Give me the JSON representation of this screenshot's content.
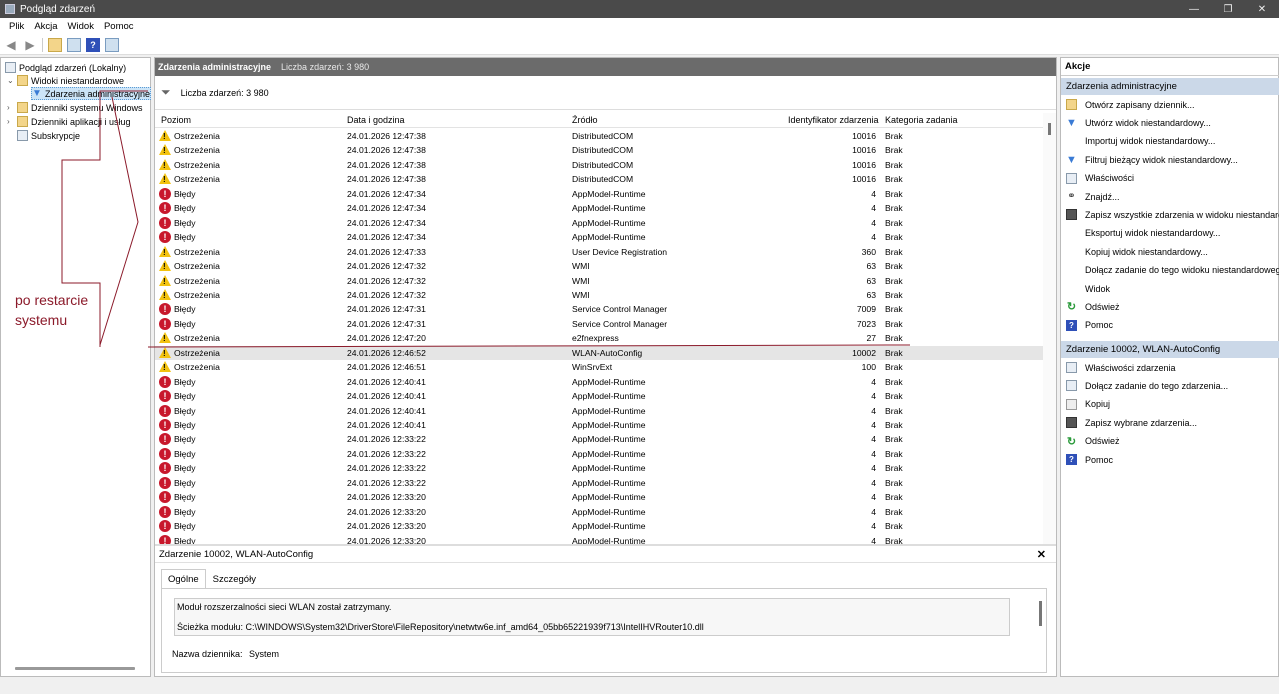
{
  "window": {
    "title": "Podgląd zdarzeń",
    "min": "—",
    "max": "❐",
    "close": "✕"
  },
  "menu": [
    "Plik",
    "Akcja",
    "Widok",
    "Pomoc"
  ],
  "tree": {
    "root": "Podgląd zdarzeń (Lokalny)",
    "custom_views": "Widoki niestandardowe",
    "admin_events": "Zdarzenia administracyjne",
    "windows_logs": "Dzienniki systemu Windows",
    "app_logs": "Dzienniki aplikacji i usług",
    "subscriptions": "Subskrypcje"
  },
  "center": {
    "header_title": "Zdarzenia administracyjne",
    "header_count": "Liczba zdarzeń: 3 980",
    "filter_text": "Liczba zdarzeń: 3 980"
  },
  "columns": [
    "Poziom",
    "Data i godzina",
    "Źródło",
    "Identyfikator zdarzenia",
    "Kategoria zadania"
  ],
  "rows": [
    {
      "level": "Ostrzeżenia",
      "type": "warn",
      "date": "24.01.2026 12:47:38",
      "source": "DistributedCOM",
      "id": "10016",
      "cat": "Brak"
    },
    {
      "level": "Ostrzeżenia",
      "type": "warn",
      "date": "24.01.2026 12:47:38",
      "source": "DistributedCOM",
      "id": "10016",
      "cat": "Brak"
    },
    {
      "level": "Ostrzeżenia",
      "type": "warn",
      "date": "24.01.2026 12:47:38",
      "source": "DistributedCOM",
      "id": "10016",
      "cat": "Brak"
    },
    {
      "level": "Ostrzeżenia",
      "type": "warn",
      "date": "24.01.2026 12:47:38",
      "source": "DistributedCOM",
      "id": "10016",
      "cat": "Brak"
    },
    {
      "level": "Błędy",
      "type": "err",
      "date": "24.01.2026 12:47:34",
      "source": "AppModel-Runtime",
      "id": "4",
      "cat": "Brak"
    },
    {
      "level": "Błędy",
      "type": "err",
      "date": "24.01.2026 12:47:34",
      "source": "AppModel-Runtime",
      "id": "4",
      "cat": "Brak"
    },
    {
      "level": "Błędy",
      "type": "err",
      "date": "24.01.2026 12:47:34",
      "source": "AppModel-Runtime",
      "id": "4",
      "cat": "Brak"
    },
    {
      "level": "Błędy",
      "type": "err",
      "date": "24.01.2026 12:47:34",
      "source": "AppModel-Runtime",
      "id": "4",
      "cat": "Brak"
    },
    {
      "level": "Ostrzeżenia",
      "type": "warn",
      "date": "24.01.2026 12:47:33",
      "source": "User Device Registration",
      "id": "360",
      "cat": "Brak"
    },
    {
      "level": "Ostrzeżenia",
      "type": "warn",
      "date": "24.01.2026 12:47:32",
      "source": "WMI",
      "id": "63",
      "cat": "Brak"
    },
    {
      "level": "Ostrzeżenia",
      "type": "warn",
      "date": "24.01.2026 12:47:32",
      "source": "WMI",
      "id": "63",
      "cat": "Brak"
    },
    {
      "level": "Ostrzeżenia",
      "type": "warn",
      "date": "24.01.2026 12:47:32",
      "source": "WMI",
      "id": "63",
      "cat": "Brak"
    },
    {
      "level": "Błędy",
      "type": "err",
      "date": "24.01.2026 12:47:31",
      "source": "Service Control Manager",
      "id": "7009",
      "cat": "Brak"
    },
    {
      "level": "Błędy",
      "type": "err",
      "date": "24.01.2026 12:47:31",
      "source": "Service Control Manager",
      "id": "7023",
      "cat": "Brak"
    },
    {
      "level": "Ostrzeżenia",
      "type": "warn",
      "date": "24.01.2026 12:47:20",
      "source": "e2fnexpress",
      "id": "27",
      "cat": "Brak"
    },
    {
      "level": "Ostrzeżenia",
      "type": "warn",
      "date": "24.01.2026 12:46:52",
      "source": "WLAN-AutoConfig",
      "id": "10002",
      "cat": "Brak",
      "selected": true
    },
    {
      "level": "Ostrzeżenia",
      "type": "warn",
      "date": "24.01.2026 12:46:51",
      "source": "WinSrvExt",
      "id": "100",
      "cat": "Brak"
    },
    {
      "level": "Błędy",
      "type": "err",
      "date": "24.01.2026 12:40:41",
      "source": "AppModel-Runtime",
      "id": "4",
      "cat": "Brak"
    },
    {
      "level": "Błędy",
      "type": "err",
      "date": "24.01.2026 12:40:41",
      "source": "AppModel-Runtime",
      "id": "4",
      "cat": "Brak"
    },
    {
      "level": "Błędy",
      "type": "err",
      "date": "24.01.2026 12:40:41",
      "source": "AppModel-Runtime",
      "id": "4",
      "cat": "Brak"
    },
    {
      "level": "Błędy",
      "type": "err",
      "date": "24.01.2026 12:40:41",
      "source": "AppModel-Runtime",
      "id": "4",
      "cat": "Brak"
    },
    {
      "level": "Błędy",
      "type": "err",
      "date": "24.01.2026 12:33:22",
      "source": "AppModel-Runtime",
      "id": "4",
      "cat": "Brak"
    },
    {
      "level": "Błędy",
      "type": "err",
      "date": "24.01.2026 12:33:22",
      "source": "AppModel-Runtime",
      "id": "4",
      "cat": "Brak"
    },
    {
      "level": "Błędy",
      "type": "err",
      "date": "24.01.2026 12:33:22",
      "source": "AppModel-Runtime",
      "id": "4",
      "cat": "Brak"
    },
    {
      "level": "Błędy",
      "type": "err",
      "date": "24.01.2026 12:33:22",
      "source": "AppModel-Runtime",
      "id": "4",
      "cat": "Brak"
    },
    {
      "level": "Błędy",
      "type": "err",
      "date": "24.01.2026 12:33:20",
      "source": "AppModel-Runtime",
      "id": "4",
      "cat": "Brak"
    },
    {
      "level": "Błędy",
      "type": "err",
      "date": "24.01.2026 12:33:20",
      "source": "AppModel-Runtime",
      "id": "4",
      "cat": "Brak"
    },
    {
      "level": "Błędy",
      "type": "err",
      "date": "24.01.2026 12:33:20",
      "source": "AppModel-Runtime",
      "id": "4",
      "cat": "Brak"
    },
    {
      "level": "Błędy",
      "type": "err",
      "date": "24.01.2026 12:33:20",
      "source": "AppModel-Runtime",
      "id": "4",
      "cat": "Brak"
    }
  ],
  "detail": {
    "title": "Zdarzenie 10002, WLAN-AutoConfig",
    "close": "✕",
    "tabs": [
      "Ogólne",
      "Szczegóły"
    ],
    "message_line1": "Moduł rozszerzalności sieci WLAN został zatrzymany.",
    "message_line2": "Ścieżka modułu: C:\\WINDOWS\\System32\\DriverStore\\FileRepository\\netwtw6e.inf_amd64_05bb65221939f713\\IntelIHVRouter10.dll",
    "log_name_label": "Nazwa dziennika:",
    "log_name_value": "System"
  },
  "actions": {
    "title": "Akcje",
    "section1": "Zdarzenia administracyjne",
    "items1": [
      {
        "label": "Otwórz zapisany dziennik...",
        "icon": "folder-icon"
      },
      {
        "label": "Utwórz widok niestandardowy...",
        "icon": "filter-icon"
      },
      {
        "label": "Importuj widok niestandardowy...",
        "icon": "blank"
      },
      {
        "label": "Filtruj bieżący widok niestandardowy...",
        "icon": "filter-icon"
      },
      {
        "label": "Właściwości",
        "icon": "page-icon"
      },
      {
        "label": "Znajdź...",
        "icon": "binoculars-icon"
      },
      {
        "label": "Zapisz wszystkie zdarzenia w widoku niestandardowym jako...",
        "icon": "save-icon"
      },
      {
        "label": "Eksportuj widok niestandardowy...",
        "icon": "blank"
      },
      {
        "label": "Kopiuj widok niestandardowy...",
        "icon": "blank"
      },
      {
        "label": "Dołącz zadanie do tego widoku niestandardowego...",
        "icon": "blank"
      },
      {
        "label": "Widok",
        "icon": "blank"
      },
      {
        "label": "Odśwież",
        "icon": "refresh-icon"
      },
      {
        "label": "Pomoc",
        "icon": "help-icon"
      }
    ],
    "section2": "Zdarzenie 10002, WLAN-AutoConfig",
    "items2": [
      {
        "label": "Właściwości zdarzenia",
        "icon": "page-icon"
      },
      {
        "label": "Dołącz zadanie do tego zdarzenia...",
        "icon": "page-icon"
      },
      {
        "label": "Kopiuj",
        "icon": "copy-icon"
      },
      {
        "label": "Zapisz wybrane zdarzenia...",
        "icon": "save-icon"
      },
      {
        "label": "Odśwież",
        "icon": "refresh-icon"
      },
      {
        "label": "Pomoc",
        "icon": "help-icon"
      }
    ]
  },
  "annotation": {
    "line1": "po restarcie",
    "line2": "systemu",
    "color": "#8b1a2a"
  },
  "colors": {
    "warning": "#f2c20f",
    "error": "#c8182c",
    "selection": "#cce4f7"
  }
}
